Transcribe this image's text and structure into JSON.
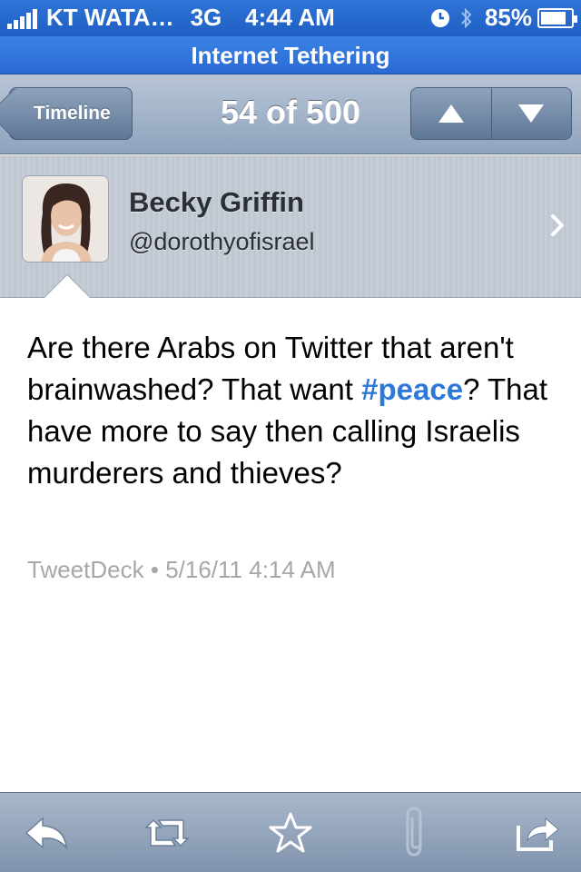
{
  "status_bar": {
    "carrier": "KT WATA…",
    "network": "3G",
    "time": "4:44 AM",
    "battery": "85%",
    "battery_level": 0.85
  },
  "tether_bar": {
    "label": "Internet Tethering"
  },
  "nav": {
    "back_label": "Timeline",
    "title": "54 of 500",
    "up_icon": "arrow-up-icon",
    "down_icon": "arrow-down-icon"
  },
  "profile": {
    "name": "Becky Griffin",
    "handle": "@dorothyofisrael"
  },
  "tweet": {
    "text_before": "Are there Arabs on Twitter that aren't brainwashed? That want ",
    "hashtag": "#peace",
    "text_after": "? That have more to say then calling Israelis murderers and thieves?",
    "source": "TweetDeck",
    "separator": "•",
    "timestamp": "5/16/11 4:14 AM"
  },
  "toolbar": {
    "icons": [
      "reply-icon",
      "retweet-icon",
      "favorite-star-icon",
      "attachment-icon",
      "share-icon"
    ]
  },
  "colors": {
    "status_bar": "#1e5fc4",
    "hashtag": "#2e78d7",
    "meta_text": "#a7a7a7"
  }
}
